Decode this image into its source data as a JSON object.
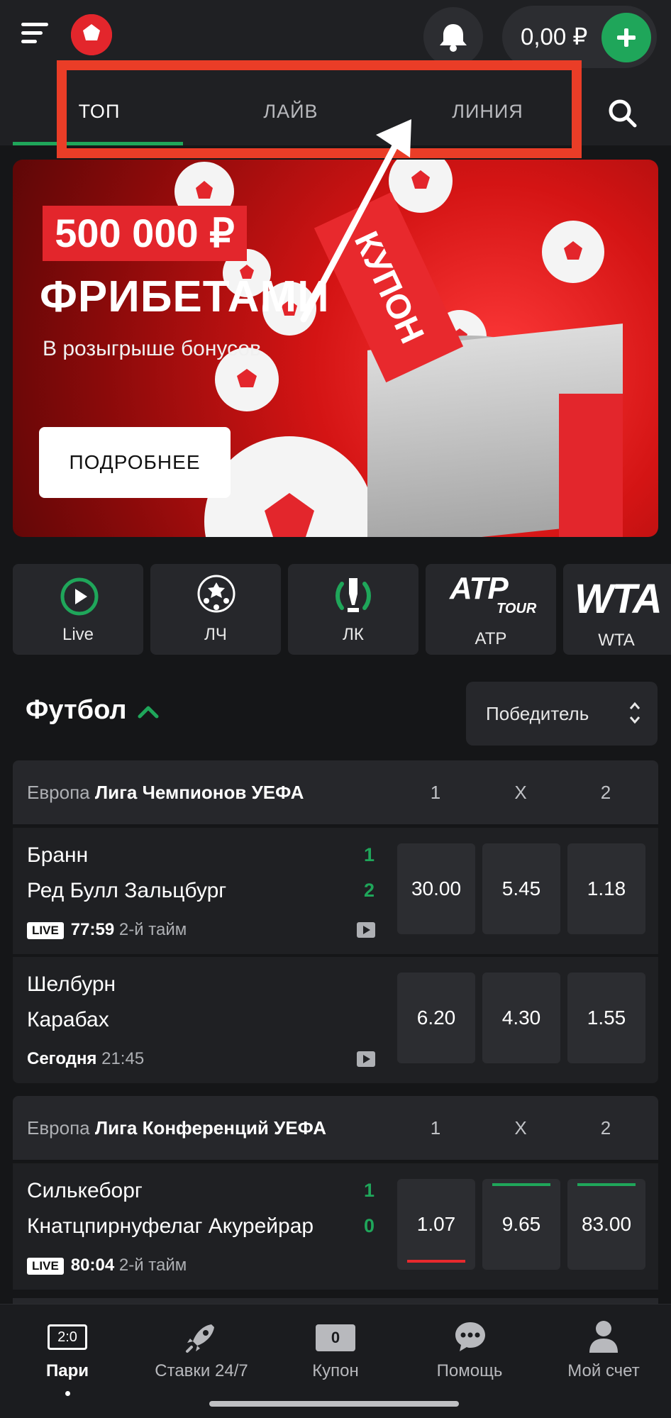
{
  "header": {
    "balance": "0,00 ₽"
  },
  "tabs": [
    {
      "label": "ТОП",
      "active": true
    },
    {
      "label": "ЛАЙВ",
      "active": false
    },
    {
      "label": "ЛИНИЯ",
      "active": false
    }
  ],
  "banner": {
    "amount": "500 000 ₽",
    "title": "ФРИБЕТАМИ",
    "subtitle": "В розыгрыше бонусов",
    "coupon_text": "КУПОН",
    "button_label": "ПОДРОБНЕЕ"
  },
  "quick_categories": [
    {
      "label": "Live",
      "icon": "play-circle-icon"
    },
    {
      "label": "ЛЧ",
      "icon": "champions-ball-icon"
    },
    {
      "label": "ЛК",
      "icon": "conference-league-icon"
    },
    {
      "label": "ATP",
      "logo": "ATP",
      "logo_sub": "TOUR",
      "icon": "atp-logo-icon"
    },
    {
      "label": "WTA",
      "logo": "WTA",
      "icon": "wta-logo-icon"
    }
  ],
  "section": {
    "title": "Футбол",
    "market_label": "Победитель"
  },
  "leagues": [
    {
      "region": "Европа",
      "name": "Лига Чемпионов УЕФА",
      "cols": [
        "1",
        "X",
        "2"
      ],
      "matches": [
        {
          "team1": "Бранн",
          "team2": "Ред Булл Зальцбург",
          "score1": "1",
          "score2": "2",
          "live": true,
          "live_label": "LIVE",
          "time": "77:59",
          "period": "2-й тайм",
          "odds": [
            "30.00",
            "5.45",
            "1.18"
          ]
        },
        {
          "team1": "Шелбурн",
          "team2": "Карабах",
          "score1": "",
          "score2": "",
          "live": false,
          "day": "Сегодня",
          "time": "21:45",
          "odds": [
            "6.20",
            "4.30",
            "1.55"
          ]
        }
      ]
    },
    {
      "region": "Европа",
      "name": "Лига Конференций УЕФА",
      "cols": [
        "1",
        "X",
        "2"
      ],
      "matches": [
        {
          "team1": "Силькеборг",
          "team2": "Кнатцпирнуфелаг Акурейрар",
          "score1": "1",
          "score2": "0",
          "live": true,
          "live_label": "LIVE",
          "time": "80:04",
          "period": "2-й тайм",
          "odds": [
            "1.07",
            "9.65",
            "83.00"
          ],
          "odd_trends": [
            "down",
            "up",
            "up"
          ]
        }
      ]
    }
  ],
  "bottom_nav": [
    {
      "label": "Пари",
      "badge": "2:0",
      "icon": "score-board-icon",
      "active": true
    },
    {
      "label": "Ставки 24/7",
      "icon": "rocket-icon",
      "active": false
    },
    {
      "label": "Купон",
      "badge": "0",
      "icon": "coupon-icon",
      "active": false
    },
    {
      "label": "Помощь",
      "icon": "chat-icon",
      "active": false
    },
    {
      "label": "Мой счет",
      "icon": "user-icon",
      "active": false
    }
  ],
  "colors": {
    "accent_green": "#1fa65a",
    "brand_red": "#e3262c",
    "highlight_red": "#ea3d27",
    "background": "#151618",
    "card": "#26272b"
  }
}
